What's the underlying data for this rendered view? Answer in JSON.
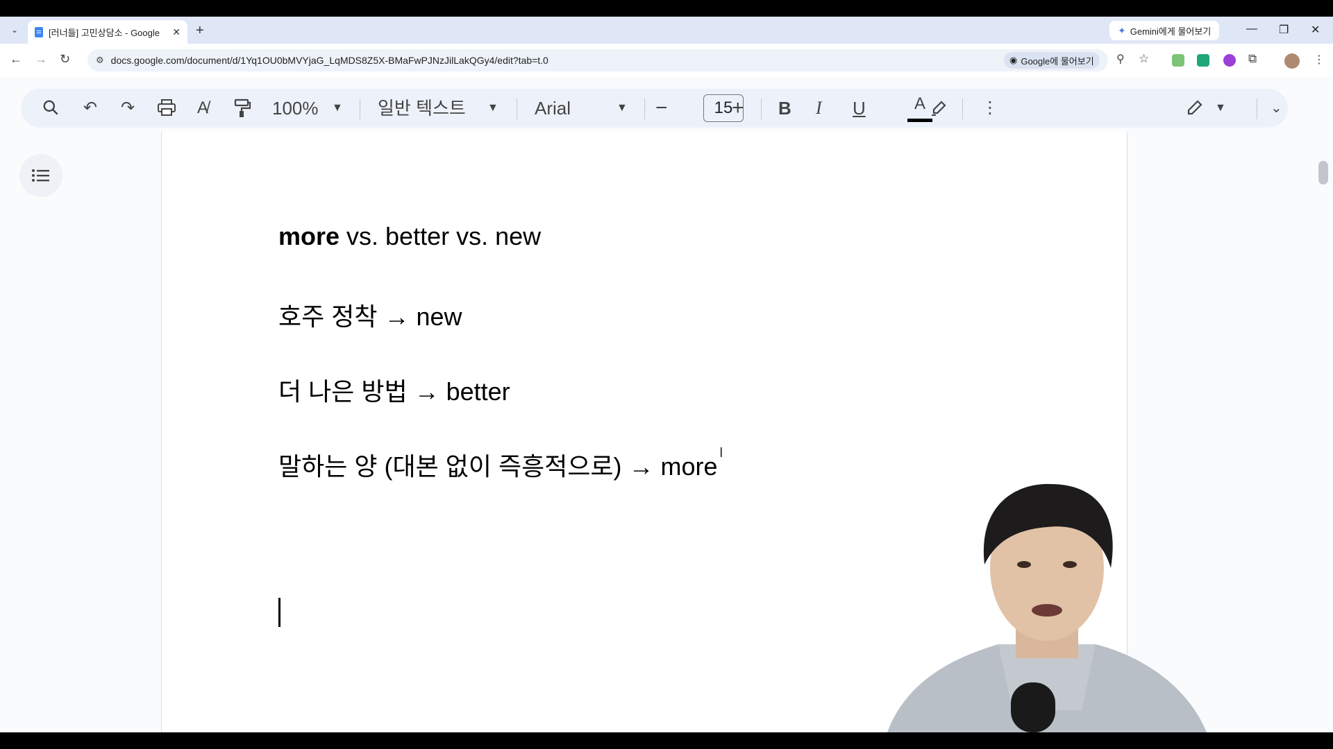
{
  "browser": {
    "tab_title": "[러너들] 고민상담소 - Google ",
    "new_tab_label": "+",
    "gemini_label": "Gemini에게 물어보기",
    "url": "docs.google.com/document/d/1Yq1OU0bMVYjaG_LqMDS8Z5X-BMaFwPJNzJilLakQGy4/edit?tab=t.0",
    "ask_google_label": "Google에 물어보기"
  },
  "toolbar": {
    "zoom": "100%",
    "style": "일반 텍스트",
    "font": "Arial",
    "font_size": "15",
    "bold_label": "B",
    "italic_label": "I",
    "underline_label": "U",
    "text_color_label": "A",
    "text_color": "#000000"
  },
  "document": {
    "line1_bold": "more",
    "line1_rest": " vs. better vs. new",
    "line2": "호주 정착 → new",
    "line3": "더 나은 방법 → better",
    "line4": "말하는 양 (대본 없이 즉흥적으로) → more"
  },
  "colors": {
    "tab_strip": "#dfe7f6",
    "toolbar": "#edf2fa",
    "accent": "#4285f4"
  }
}
